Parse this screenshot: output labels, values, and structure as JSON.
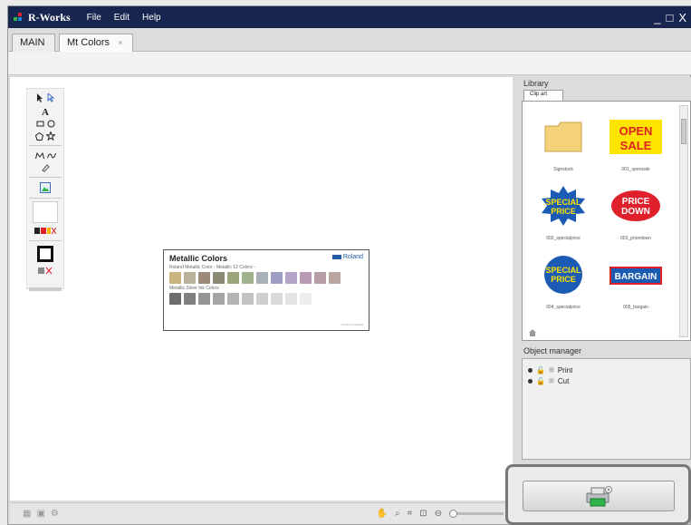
{
  "titlebar": {
    "app_name": "R-Works",
    "menu": [
      "File",
      "Edit",
      "Help"
    ],
    "window_controls": [
      "_",
      "□",
      "X"
    ]
  },
  "tabs": [
    {
      "label": "MAIN",
      "active": false
    },
    {
      "label": "Mt Colors",
      "active": true,
      "close": "×"
    }
  ],
  "canvas": {
    "card": {
      "title": "Metallic Colors",
      "brand": "Roland",
      "row1_label": "Roland Metallic Color - Metallic 12 Colors -",
      "row2_label": "Metallic Silver Ink Colors",
      "row1_colors": [
        "#c9b57e",
        "#b9b19a",
        "#9c8a78",
        "#8b8a74",
        "#9aa57a",
        "#9fb18d",
        "#a9b0b7",
        "#9e9ec4",
        "#b3a3c6",
        "#b99ab5",
        "#b79ea5",
        "#b9a5a0"
      ],
      "row2_colors": [
        "#6d6d6d",
        "#808080",
        "#949494",
        "#a5a5a5",
        "#b4b4b4",
        "#c2c2c2",
        "#cfcfcf",
        "#dadada",
        "#e4e4e4",
        "#eeeeee"
      ],
      "footer": "Printed by Roland"
    }
  },
  "library": {
    "title": "Library",
    "tab": "Clip art",
    "items": [
      {
        "caption": "Signstock",
        "kind": "folder"
      },
      {
        "caption": "001_opensale",
        "kind": "sign",
        "line1": "OPEN",
        "line2": "SALE",
        "fg": "#e02020",
        "bg": "#ffe400"
      },
      {
        "caption": "002_specialprice",
        "kind": "burst",
        "line1": "SPECIAL",
        "line2": "PRICE",
        "fg": "#ffe400",
        "bg": "#1c5bb3"
      },
      {
        "caption": "003_pricedown",
        "kind": "oval",
        "line1": "PRICE",
        "line2": "DOWN",
        "fg": "#ffffff",
        "bg": "#e0202a"
      },
      {
        "caption": "004_specialprice",
        "kind": "circle",
        "line1": "SPECIAL",
        "line2": "PRICE",
        "fg": "#ffe400",
        "bg": "#1c5bb3"
      },
      {
        "caption": "005_bargain",
        "kind": "rect",
        "line1": "BARGAIN",
        "line2": "",
        "fg": "#ffffff",
        "bg": "#1c5bb3"
      }
    ]
  },
  "object_manager": {
    "title": "Object manager",
    "items": [
      "Print",
      "Cut"
    ]
  },
  "output_button": {
    "label": ""
  }
}
